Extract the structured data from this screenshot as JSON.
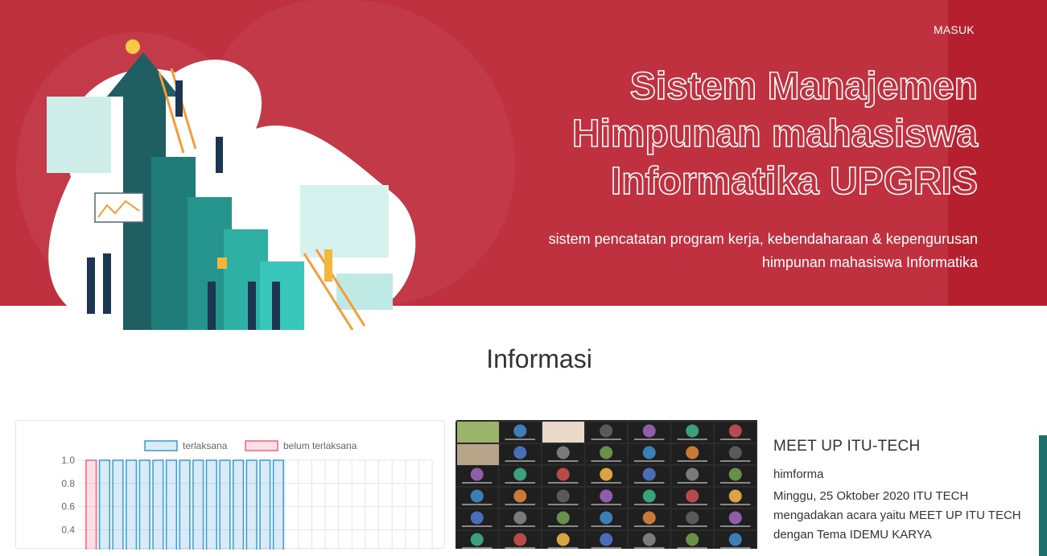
{
  "nav": {
    "login_label": "MASUK"
  },
  "hero": {
    "title_line1": "Sistem Manajemen",
    "title_line2": "Himpunan mahasiswa",
    "title_line3": "Informatika UPGRIS",
    "subtitle_line1": "sistem pencatatan program kerja, kebendaharaan & kepengurusan",
    "subtitle_line2": "himpunan mahasiswa Informatika"
  },
  "info": {
    "title": "Informasi"
  },
  "chart_data": {
    "type": "bar",
    "series": [
      {
        "name": "terlaksana",
        "values": [
          0,
          1,
          1,
          1,
          1,
          1,
          1,
          1,
          1,
          1,
          1,
          1,
          1,
          1,
          1,
          0,
          0,
          0,
          0,
          0,
          0,
          0,
          0,
          0,
          0,
          0
        ]
      },
      {
        "name": "belum terlaksana",
        "values": [
          1,
          0,
          0,
          0,
          0,
          0,
          0,
          0,
          0,
          0,
          0,
          0,
          0,
          0,
          0,
          0,
          0,
          0,
          0,
          0,
          0,
          0,
          0,
          0,
          0,
          0
        ]
      }
    ],
    "yticks": [
      "1.0",
      "0.8",
      "0.6",
      "0.4"
    ],
    "ylim": [
      0,
      1
    ],
    "legend": "top",
    "colors": {
      "terlaksana": "#3a9bd6",
      "belum terlaksana": "#f06483"
    }
  },
  "news": {
    "title": "MEET UP ITU-TECH",
    "author": "himforma",
    "text": "Minggu, 25 Oktober 2020 ITU TECH mengadakan acara yaitu MEET UP ITU TECH dengan Tema IDEMU KARYA"
  }
}
